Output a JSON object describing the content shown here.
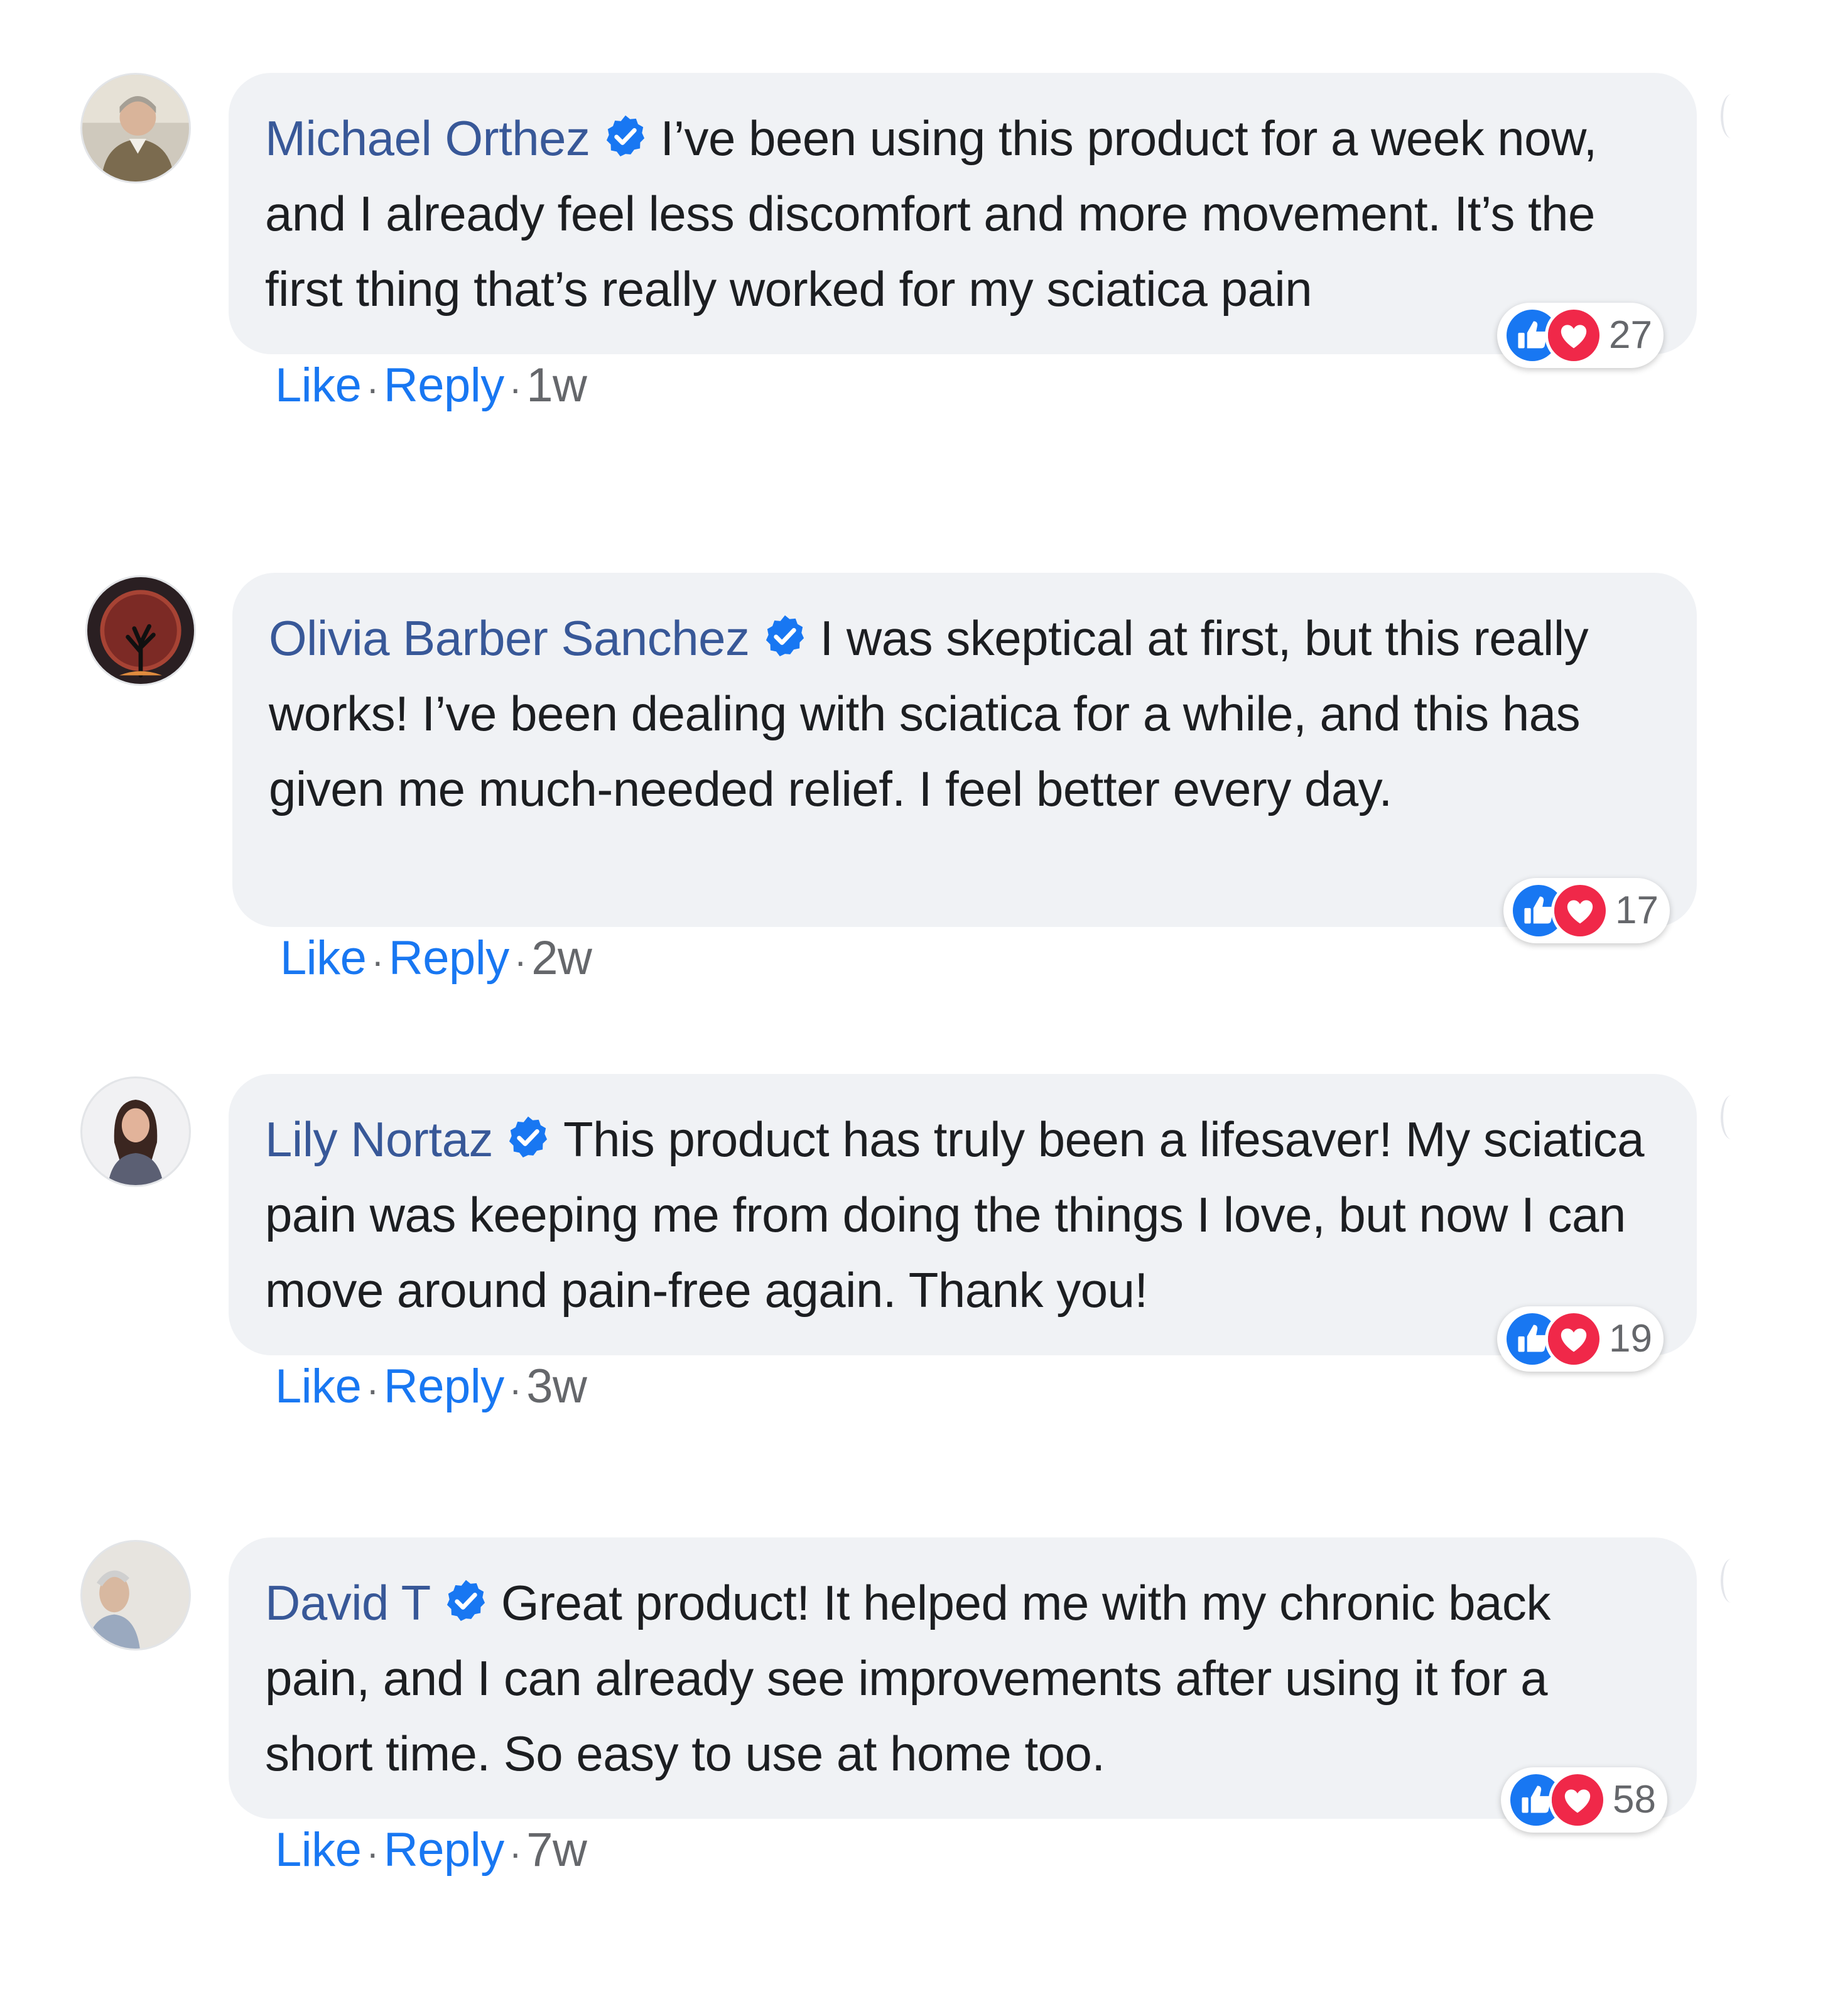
{
  "colors": {
    "name_link": "#385898",
    "action_link": "#1877f2",
    "bubble_bg": "#f0f2f5",
    "verified_blue": "#1877f2",
    "like_blue": "#1877f2",
    "love_red": "#f02849",
    "meta_gray": "#65676b"
  },
  "icons": {
    "verified": "verified-badge-icon",
    "like_reaction": "thumbs-up-icon",
    "love_reaction": "heart-icon"
  },
  "comments": [
    {
      "author": "Michael Orthez",
      "text": "I’ve been using this product for a week now, and I already feel less discomfort and more movement. It’s the first thing that’s really worked for my sciatica pain",
      "reaction_count": "27",
      "like_label": "Like",
      "reply_label": "Reply",
      "separator": "·",
      "time": "1w"
    },
    {
      "author": "Olivia Barber Sanchez",
      "text": "I was skeptical at first, but this really works! I’ve been dealing with sciatica for a while, and this has given me much-needed relief. I feel better every day.",
      "reaction_count": "17",
      "like_label": "Like",
      "reply_label": "Reply",
      "separator": "·",
      "time": "2w"
    },
    {
      "author": "Lily Nortaz",
      "text": "This product has truly been a lifesaver! My sciatica pain was keeping me from doing the things I love, but now I can move around pain-free again. Thank you!",
      "reaction_count": "19",
      "like_label": "Like",
      "reply_label": "Reply",
      "separator": "·",
      "time": "3w"
    },
    {
      "author": "David T",
      "text": "Great product! It helped me with my chronic back pain, and I can already see improvements after using it for a short time. So easy to use at home too.",
      "reaction_count": "58",
      "like_label": "Like",
      "reply_label": "Reply",
      "separator": "·",
      "time": "7w"
    }
  ]
}
